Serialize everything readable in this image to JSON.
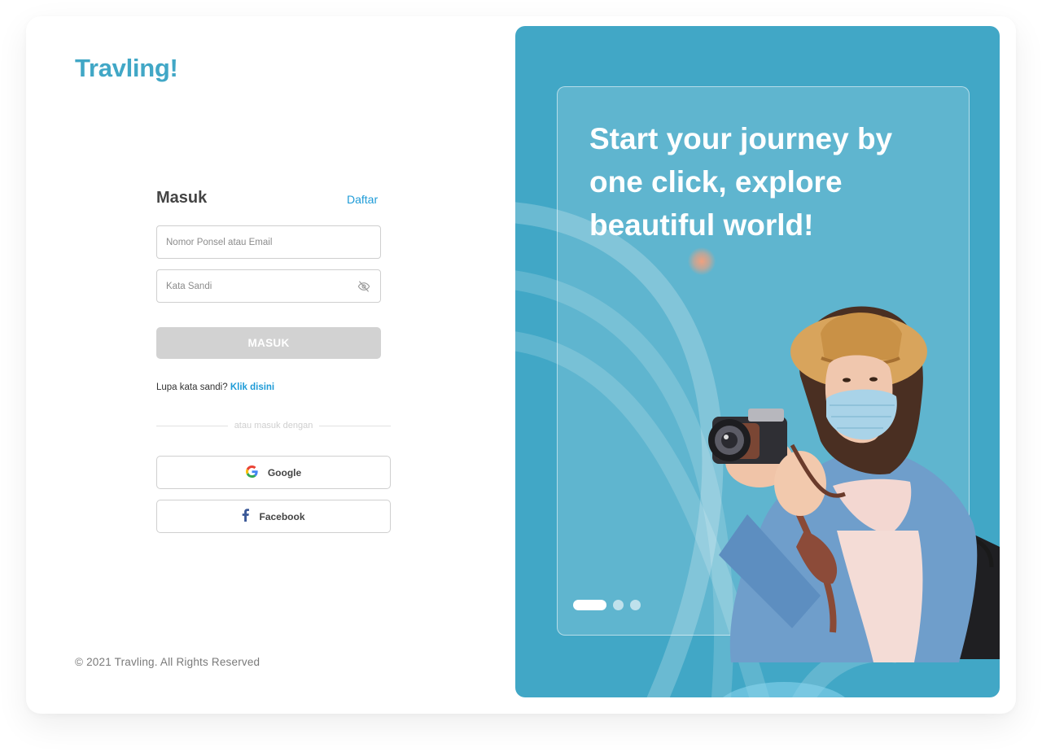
{
  "brand": {
    "name": "Travling!",
    "color": "#41a7c6"
  },
  "login": {
    "title": "Masuk",
    "register_link": "Daftar",
    "phone_email_placeholder": "Nomor Ponsel atau Email",
    "password_placeholder": "Kata Sandi",
    "submit_label": "MASUK",
    "forgot_text": "Lupa kata sandi?",
    "forgot_link": "Klik disini",
    "divider_text": "atau masuk dengan",
    "google_label": "Google",
    "facebook_label": "Facebook"
  },
  "footer": {
    "copyright": "© 2021 Travling. All Rights Reserved"
  },
  "hero": {
    "tagline": "Start your journey by one click, explore beautiful world!",
    "carousel": {
      "total_slides": 3,
      "active_index": 0
    }
  },
  "icons": {
    "password_toggle": "eye-off-icon",
    "google": "google-icon",
    "facebook": "facebook-icon"
  },
  "colors": {
    "accent": "#41a7c6",
    "link": "#1e9bd7",
    "button_disabled": "#d2d2d2",
    "hero_background": "#41a7c6"
  }
}
